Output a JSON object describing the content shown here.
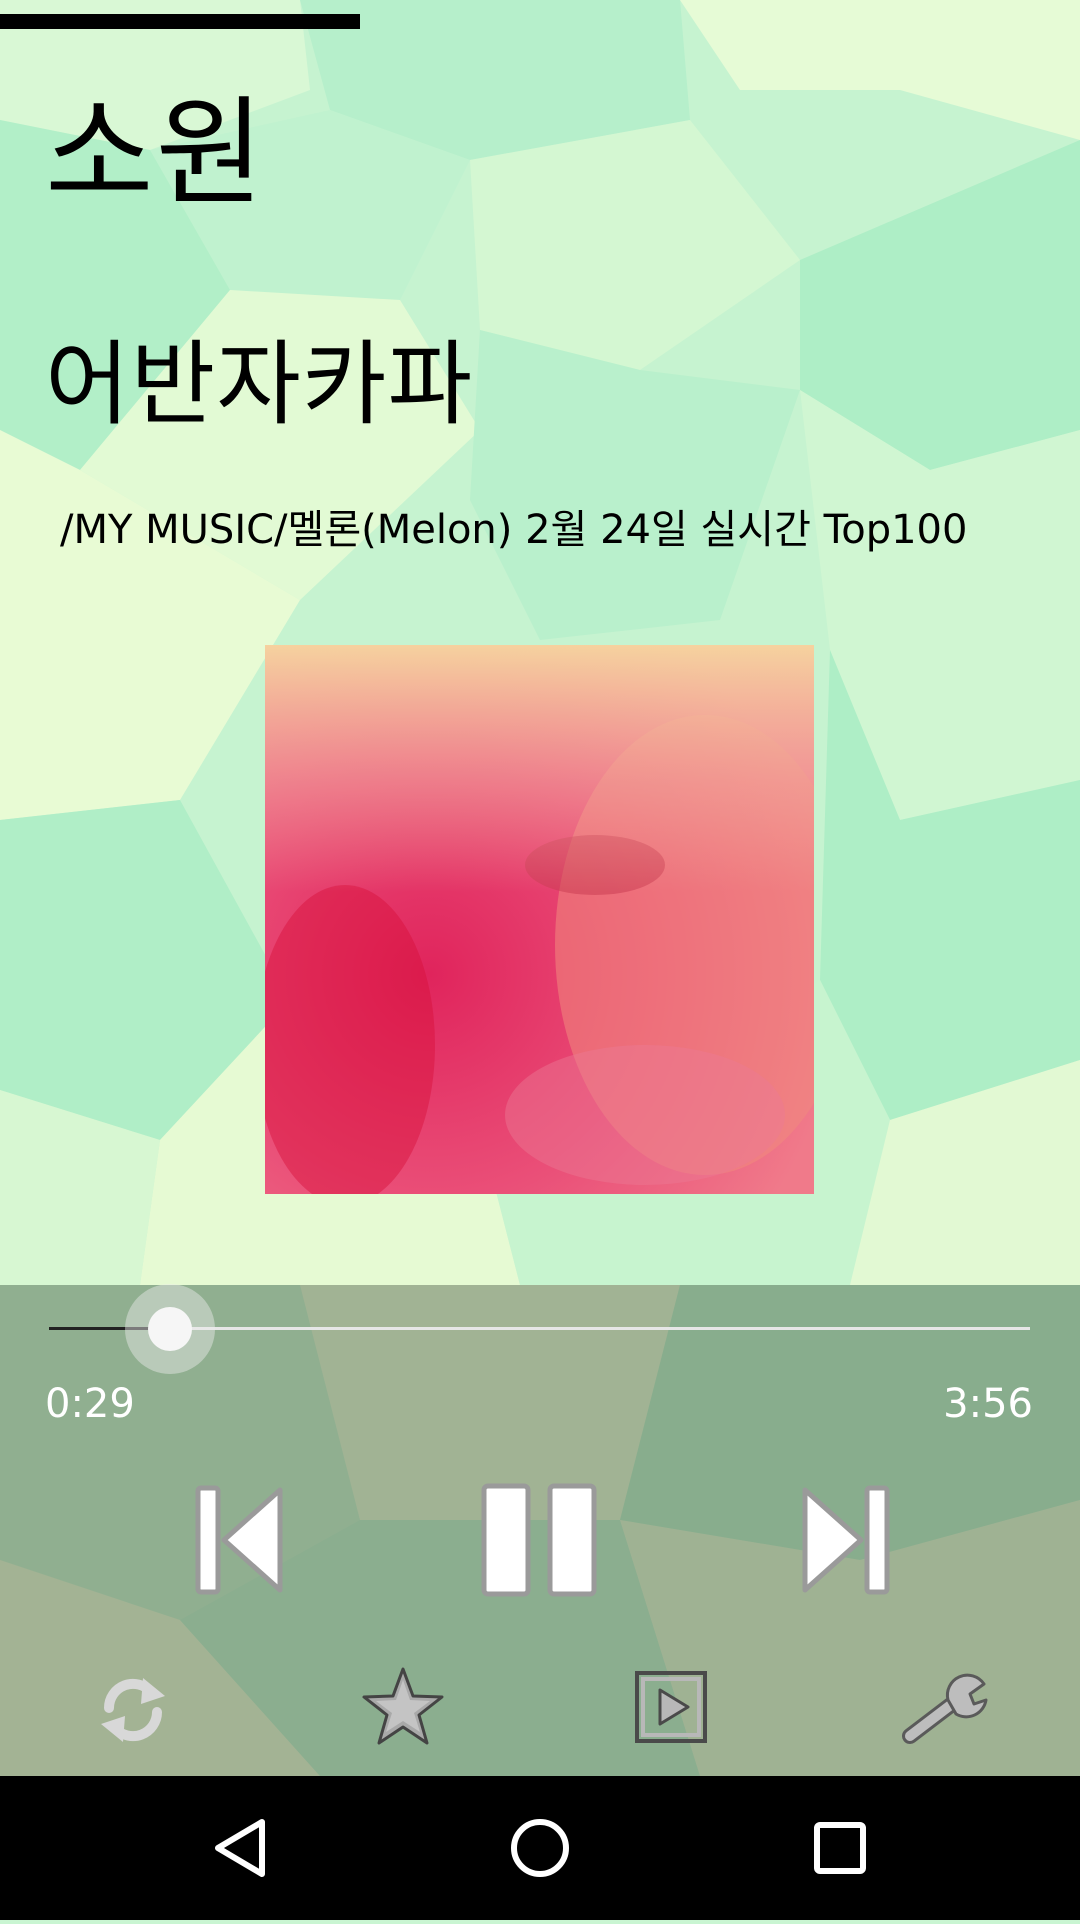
{
  "song": {
    "title": "소원",
    "artist": "어반자카파",
    "path": "/MY MUSIC/멜론(Melon) 2월 24일 실시간 Top100"
  },
  "playback": {
    "elapsed": "0:29",
    "total": "3:56",
    "progress_fraction": 0.123
  },
  "controls": {
    "transport": [
      "previous-icon",
      "pause-icon",
      "next-icon"
    ],
    "toolbar": [
      "repeat-icon",
      "star-icon",
      "playlist-play-icon",
      "wrench-icon"
    ]
  },
  "navigation": [
    "back-icon",
    "home-icon",
    "recents-icon"
  ],
  "colors": {
    "background_mint": "#b4f0c8",
    "background_light": "#e8fbd2",
    "control_overlay": "#7a8f72",
    "nav_bar": "#000000",
    "time_text": "#ffffff"
  }
}
